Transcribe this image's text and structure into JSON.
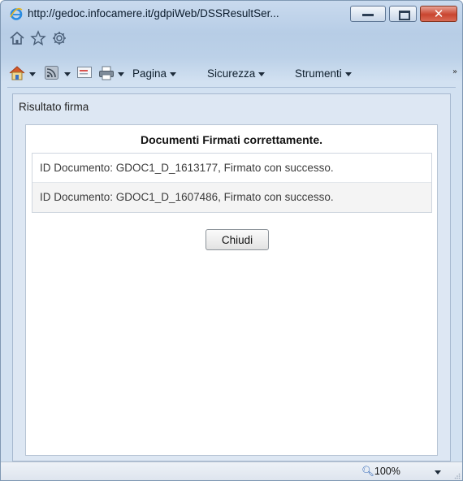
{
  "window": {
    "url": "http://gedoc.infocamere.it/gdpiWeb/DSSResultSer..."
  },
  "favorites_bar": {
    "icons": [
      "home-icon",
      "star-icon",
      "gear-icon"
    ]
  },
  "command_bar": {
    "icons": [
      "home-icon",
      "feeds-icon",
      "mail-icon",
      "print-icon"
    ],
    "menus": [
      {
        "label": "Pagina"
      },
      {
        "label": "Sicurezza"
      },
      {
        "label": "Strumenti"
      }
    ],
    "overflow": "»"
  },
  "content": {
    "panel_title": "Risultato firma",
    "heading": "Documenti Firmati correttamente.",
    "rows": [
      "ID Documento: GDOC1_D_1613177, Firmato con successo.",
      "ID Documento: GDOC1_D_1607486, Firmato con successo."
    ],
    "close_label": "Chiudi"
  },
  "status_bar": {
    "zoom": "100%"
  },
  "colors": {
    "chrome": "#c3d6ec",
    "close_button": "#c9452f",
    "panel_bg": "#dde7f3"
  }
}
